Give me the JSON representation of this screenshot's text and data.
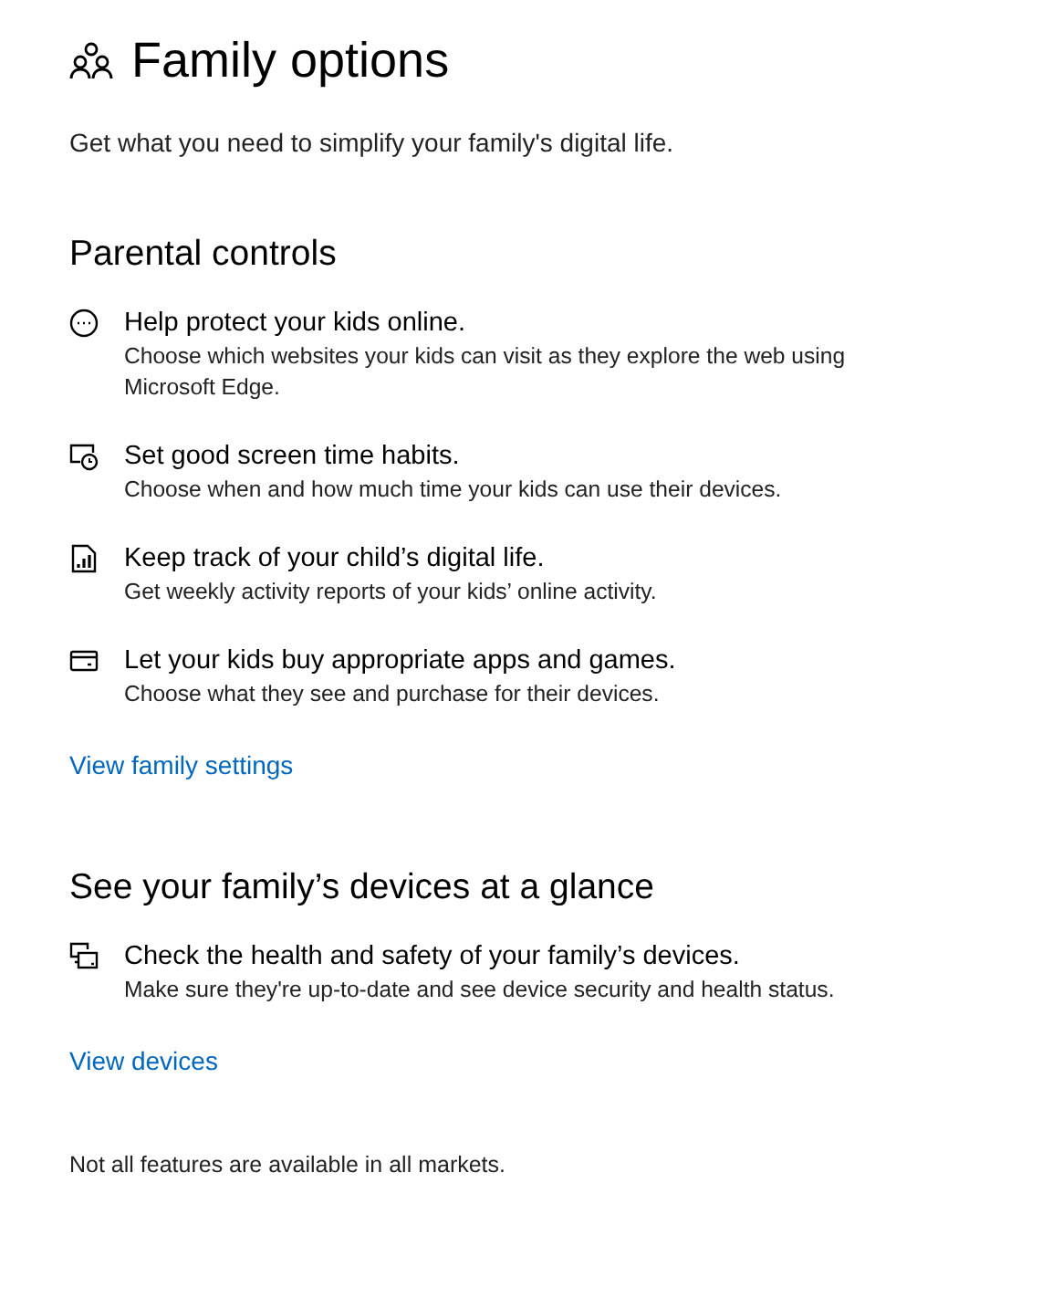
{
  "page": {
    "title": "Family options",
    "subtitle": "Get what you need to simplify your family's digital life."
  },
  "sections": [
    {
      "heading": "Parental controls",
      "items": [
        {
          "kind": "web",
          "title": "Help protect your kids online.",
          "description": "Choose which websites your kids can visit as they explore the web using Microsoft Edge."
        },
        {
          "kind": "screen-time",
          "title": "Set good screen time habits.",
          "description": "Choose when and how much time your kids can use their devices."
        },
        {
          "kind": "report",
          "title": "Keep track of your child’s digital life.",
          "description": "Get weekly activity reports of your kids’ online activity."
        },
        {
          "kind": "purchase",
          "title": "Let your kids buy appropriate apps and games.",
          "description": "Choose what they see and purchase for their devices."
        }
      ],
      "link": "View family settings"
    },
    {
      "heading": "See your family’s devices at a glance",
      "items": [
        {
          "kind": "devices",
          "title": "Check the health and safety of your family’s devices.",
          "description": "Make sure they're up-to-date and see device security and health status."
        }
      ],
      "link": "View devices"
    }
  ],
  "footnote": "Not all features are available in all markets."
}
